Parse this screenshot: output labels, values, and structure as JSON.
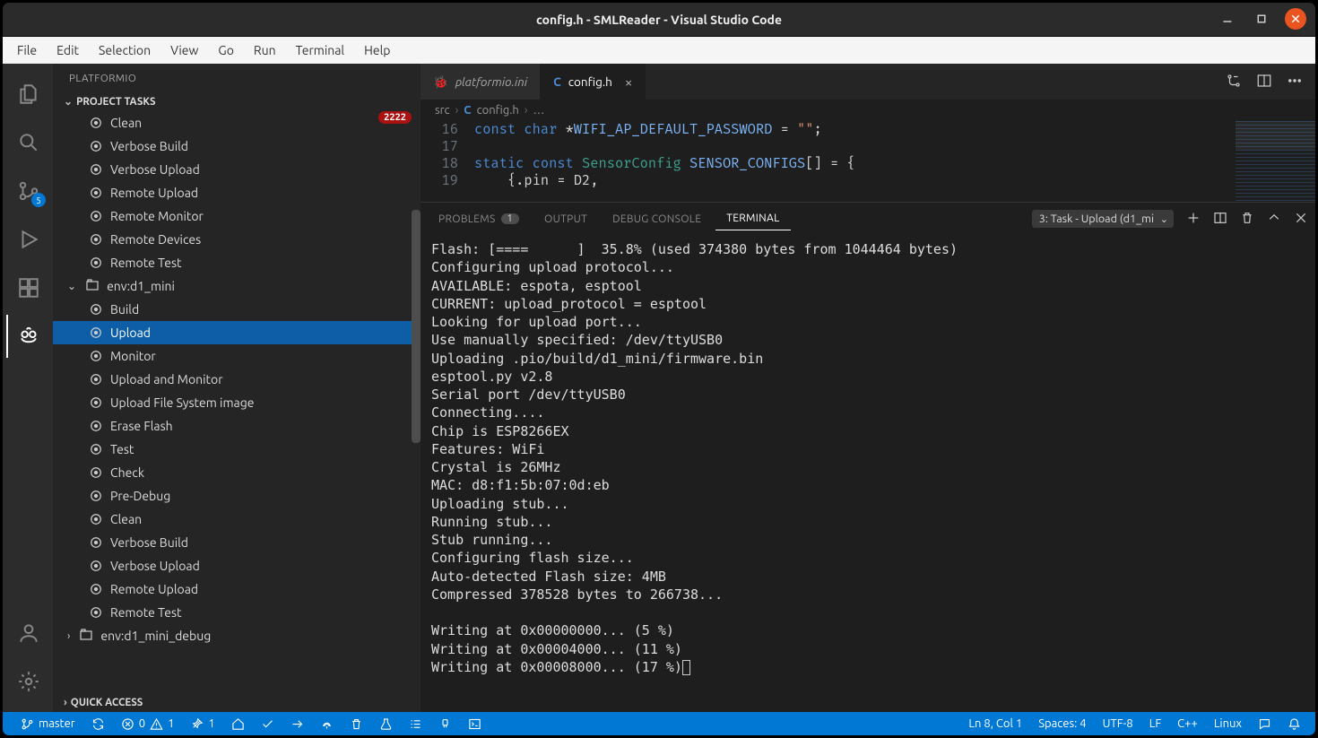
{
  "window": {
    "title": "config.h - SMLReader - Visual Studio Code"
  },
  "menu": [
    "File",
    "Edit",
    "Selection",
    "View",
    "Go",
    "Run",
    "Terminal",
    "Help"
  ],
  "activity_bar": {
    "scm_badge": "5"
  },
  "sidebar": {
    "header": "PLATFORMIO",
    "section": "PROJECT TASKS",
    "error_badge": "2222",
    "tasks_group_a": [
      "Clean",
      "Verbose Build",
      "Verbose Upload",
      "Remote Upload",
      "Remote Monitor",
      "Remote Devices",
      "Remote Test"
    ],
    "env_a": "env:d1_mini",
    "tasks_env_a": [
      "Build",
      "Upload",
      "Monitor",
      "Upload and Monitor",
      "Upload File System image",
      "Erase Flash",
      "Test",
      "Check",
      "Pre-Debug",
      "Clean",
      "Verbose Build",
      "Verbose Upload",
      "Remote Upload",
      "Remote Test"
    ],
    "selected_task": "Upload",
    "env_b": "env:d1_mini_debug",
    "footer": "QUICK ACCESS"
  },
  "tabs": [
    {
      "label": "platformio.ini",
      "icon_color": "#e97f2b"
    },
    {
      "label": "config.h",
      "icon_color": "#4b8bd4",
      "active": true
    }
  ],
  "breadcrumb": {
    "parts": [
      "src",
      "config.h",
      "…"
    ]
  },
  "code": {
    "lines": [
      {
        "num": "16",
        "html": "<span class='kw'>const</span> <span class='kw'>char</span> <span class='dim'>*</span><span class='const'>WIFI_AP_DEFAULT_PASSWORD</span> <span class='dim'>=</span> <span class='str'>\"\"</span><span class='dim'>;</span>"
      },
      {
        "num": "17",
        "html": ""
      },
      {
        "num": "18",
        "html": "<span class='kw'>static</span> <span class='kw'>const</span> <span class='type'>SensorConfig</span> <span class='const'>SENSOR_CONFIGS</span><span class='dim'>[] = {</span>"
      },
      {
        "num": "19",
        "html": "    <span class='dim'>{.pin = D2,</span>"
      }
    ]
  },
  "panel": {
    "tabs": [
      {
        "label": "PROBLEMS",
        "badge": "1"
      },
      {
        "label": "OUTPUT"
      },
      {
        "label": "DEBUG CONSOLE"
      },
      {
        "label": "TERMINAL",
        "active": true
      }
    ],
    "terminal_selector": "3: Task - Upload (d1_mi",
    "terminal_lines": [
      "Flash: [====      ]  35.8% (used 374380 bytes from 1044464 bytes)",
      "Configuring upload protocol...",
      "AVAILABLE: espota, esptool",
      "CURRENT: upload_protocol = esptool",
      "Looking for upload port...",
      "Use manually specified: /dev/ttyUSB0",
      "Uploading .pio/build/d1_mini/firmware.bin",
      "esptool.py v2.8",
      "Serial port /dev/ttyUSB0",
      "Connecting....",
      "Chip is ESP8266EX",
      "Features: WiFi",
      "Crystal is 26MHz",
      "MAC: d8:f1:5b:07:0d:eb",
      "Uploading stub...",
      "Running stub...",
      "Stub running...",
      "Configuring flash size...",
      "Auto-detected Flash size: 4MB",
      "Compressed 378528 bytes to 266738...",
      "",
      "Writing at 0x00000000... (5 %)",
      "Writing at 0x00004000... (11 %)",
      "Writing at 0x00008000... (17 %)"
    ]
  },
  "status": {
    "branch": "master",
    "errors": "0",
    "warnings": "1",
    "tools_warn": "1",
    "cursor": "Ln 8, Col 1",
    "spaces": "Spaces: 4",
    "encoding": "UTF-8",
    "eol": "LF",
    "lang": "C++",
    "os": "Linux"
  }
}
